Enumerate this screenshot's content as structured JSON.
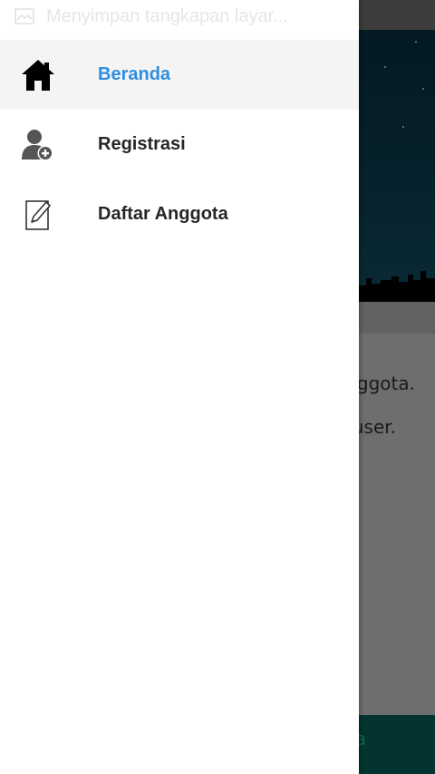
{
  "status_bar": {
    "notification_text": "Menyimpan tangkapan layar...",
    "icon": "screenshot-icon"
  },
  "drawer": {
    "items": [
      {
        "label": "Beranda",
        "icon": "home-icon",
        "active": true
      },
      {
        "label": "Registrasi",
        "icon": "add-user-icon",
        "active": false
      },
      {
        "label": "Daftar Anggota",
        "icon": "edit-document-icon",
        "active": false
      }
    ]
  },
  "background": {
    "text_line_1": "ggota.",
    "text_line_2": "user.",
    "bottom_bar_label": "a"
  },
  "colors": {
    "active_label": "#2d8ee0",
    "label": "#262626",
    "active_row": "#f4f4f4",
    "scrim": "#6e6e6e"
  }
}
